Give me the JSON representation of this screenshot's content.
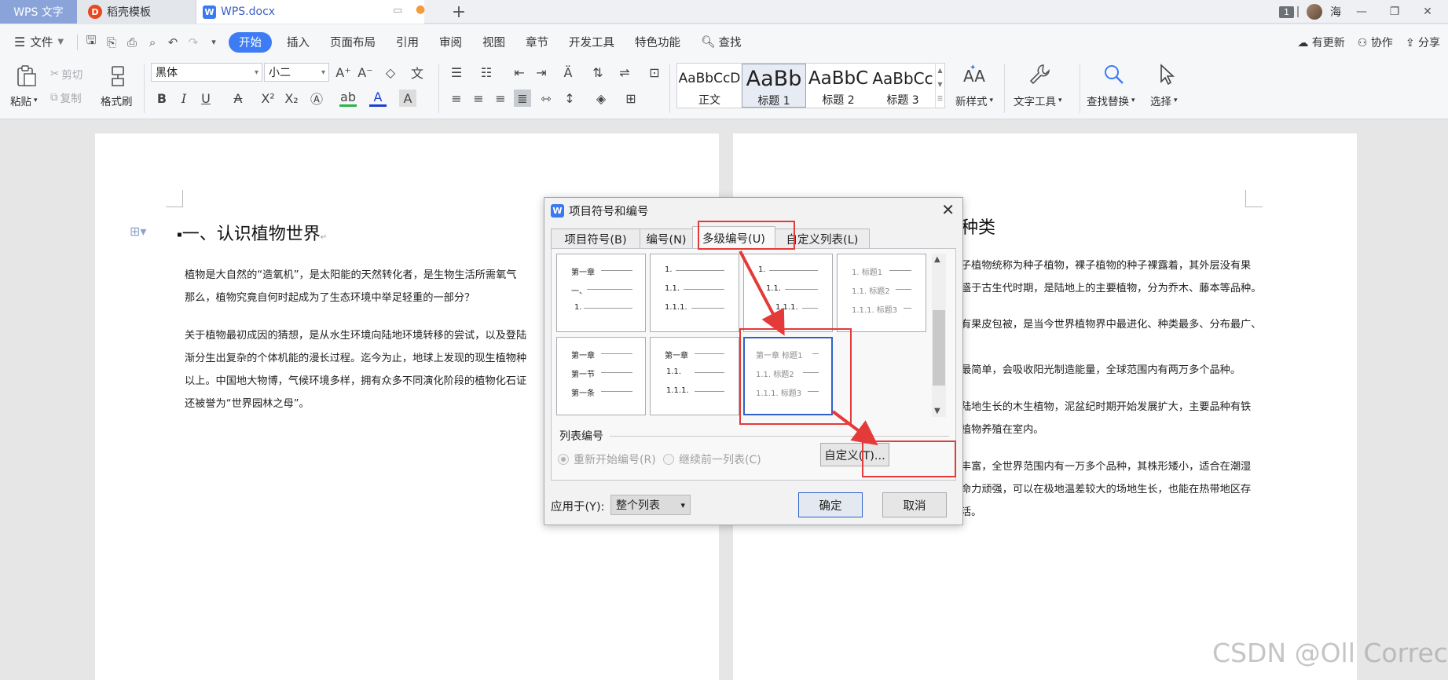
{
  "tabs": {
    "app": "WPS 文字",
    "template": "稻壳模板",
    "document": "WPS.docx",
    "new_tab": "+"
  },
  "window": {
    "badge": "1",
    "user": "海"
  },
  "menu": {
    "file": "文件",
    "items": [
      "开始",
      "插入",
      "页面布局",
      "引用",
      "审阅",
      "视图",
      "章节",
      "开发工具",
      "特色功能"
    ],
    "search": "查找",
    "update": "有更新",
    "collab": "协作",
    "share": "分享"
  },
  "ribbon": {
    "paste": "粘贴",
    "cut": "剪切",
    "copy": "复制",
    "format_painter": "格式刷",
    "font_name": "黑体",
    "font_size": "小二",
    "styles": [
      {
        "preview": "AaBbCcD",
        "name": "正文"
      },
      {
        "preview": "AaBb",
        "name": "标题 1"
      },
      {
        "preview": "AaBbC",
        "name": "标题 2"
      },
      {
        "preview": "AaBbCc",
        "name": "标题 3"
      }
    ],
    "new_style": "新样式",
    "text_tools": "文字工具",
    "find_replace": "查找替换",
    "select": "选择"
  },
  "document": {
    "heading": "一、认识植物世界",
    "p1": [
      "植物是大自然的“造氧机”，是太阳能的天然转化者，是生物生活所需氧气",
      "那么，植物究竟自何时起成为了生态环境中举足轻重的一部分？"
    ],
    "p2": [
      "关于植物最初成因的猜想，是从水生环境向陆地环境转移的尝试，以及登陆",
      "渐分生出复杂的个体机能的漫长过程。迄今为止，地球上发现的现生植物种",
      "以上。中国地大物博，气候环境多样，拥有众多不同演化阶段的植物化石证",
      "还被誉为“世界园林之母”。"
    ],
    "page2_heading": "种类",
    "page2_lines": [
      "子植物统称为种子植物，裸子植物的种子裸露着，其外层没有果",
      "盛于古生代时期，是陆地上的主要植物，分为乔木、藤本等品种。",
      "有果皮包被，是当今世界植物界中最进化、种类最多、分布最广、",
      "",
      "最简单，会吸收阳光制造能量，全球范围内有两万多个品种。",
      "",
      "陆地生长的木生植物，泥盆纪时期开始发展扩大，主要品种有铁",
      "植物养殖在室内。",
      "",
      "丰富，全世界范围内有一万多个品种，其株形矮小，适合在潮湿",
      "命力顽强，可以在极地温差较大的场地生长，也能在热带地区存",
      "活。"
    ]
  },
  "dialog": {
    "title": "项目符号和编号",
    "tabs": [
      "项目符号(B)",
      "编号(N)",
      "多级编号(U)",
      "自定义列表(L)"
    ],
    "presets": [
      {
        "lines": [
          "第一章",
          "一、",
          "1."
        ],
        "gray": false
      },
      {
        "lines": [
          "1.",
          "1.1.",
          "1.1.1."
        ],
        "gray": false
      },
      {
        "lines": [
          "1.",
          "1.1.",
          "1.1.1."
        ],
        "gray": false
      },
      {
        "lines": [
          "1. 标题1",
          "1.1. 标题2",
          "1.1.1. 标题3"
        ],
        "gray": true
      },
      {
        "lines": [
          "第一章",
          "第一节",
          "第一条"
        ],
        "gray": false
      },
      {
        "lines": [
          "第一章",
          "1.1.",
          "1.1.1."
        ],
        "gray": false
      },
      {
        "lines": [
          "第一章 标题1",
          "1.1. 标题2",
          "1.1.1. 标题3"
        ],
        "gray": true
      }
    ],
    "list_number_label": "列表编号",
    "restart": "重新开始编号(R)",
    "continue": "继续前一列表(C)",
    "customize": "自定义(T)...",
    "apply_label": "应用于(Y):",
    "apply_value": "整个列表",
    "ok": "确定",
    "cancel": "取消"
  },
  "watermark": "CSDN @Oll Correct"
}
